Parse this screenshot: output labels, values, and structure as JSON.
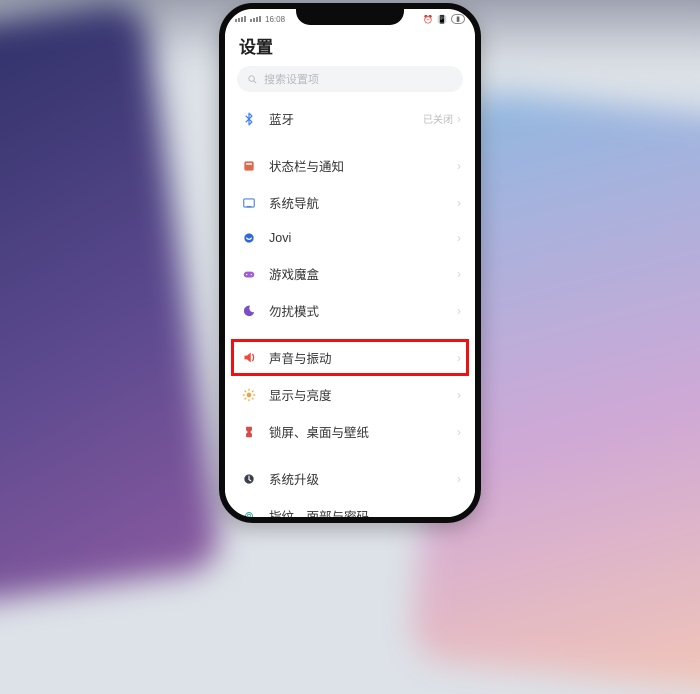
{
  "statusbar": {
    "time": "16:08"
  },
  "title": "设置",
  "search": {
    "placeholder": "搜索设置项"
  },
  "rows": {
    "bluetooth": {
      "label": "蓝牙",
      "status": "已关闭"
    },
    "status_notif": {
      "label": "状态栏与通知"
    },
    "nav": {
      "label": "系统导航"
    },
    "jovi": {
      "label": "Jovi"
    },
    "gamebox": {
      "label": "游戏魔盒"
    },
    "dnd": {
      "label": "勿扰模式"
    },
    "sound": {
      "label": "声音与振动"
    },
    "display": {
      "label": "显示与亮度"
    },
    "lock": {
      "label": "锁屏、桌面与壁纸"
    },
    "update": {
      "label": "系统升级"
    },
    "fingerprint": {
      "label": "指纹、面部与密码"
    }
  },
  "colors": {
    "bluetooth": "#3b7cf5",
    "status_notif": "#e0694a",
    "nav": "#4e86e0",
    "jovi": "#2f67d8",
    "gamebox": "#a25bd4",
    "dnd": "#7a4fc4",
    "sound": "#f04a3a",
    "display": "#f2a23c",
    "lock": "#d94b4b",
    "update": "#3a3f49",
    "fingerprint": "#3aa7a0"
  }
}
